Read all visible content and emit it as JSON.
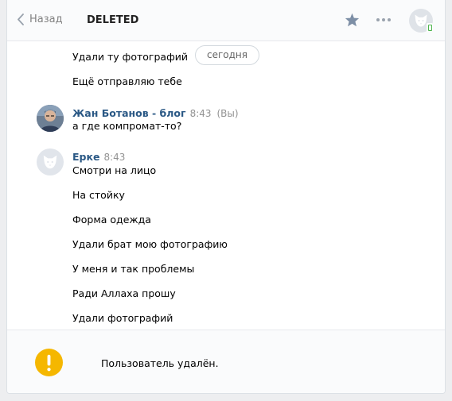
{
  "header": {
    "back_label": "Назад",
    "title": "DELETED"
  },
  "date_pill": "сегодня",
  "messages_top": [
    "Удали ту фотографий",
    "Ещё отправляю тебе"
  ],
  "group1": {
    "author": "Жан Ботанов - блог",
    "time": "8:43",
    "you_tag": "(Вы)",
    "messages": [
      "а где компромат-то?"
    ]
  },
  "group2": {
    "author": "Ерке",
    "time": "8:43",
    "messages": [
      "Смотри на лицо",
      "На стойку",
      "Форма одежда",
      "Удали брат мою фотографию",
      "У меня и так проблемы",
      "Ради Аллаха прошу",
      "Удали фотографий"
    ]
  },
  "footer": {
    "text": "Пользователь удалён."
  },
  "colors": {
    "link": "#2a5885",
    "warning": "#f5b700",
    "icon_gray": "#99a2ad"
  },
  "icons": [
    "chevron-left-icon",
    "star-icon",
    "more-icon",
    "dog-avatar-icon",
    "mobile-online-icon",
    "warning-icon"
  ]
}
